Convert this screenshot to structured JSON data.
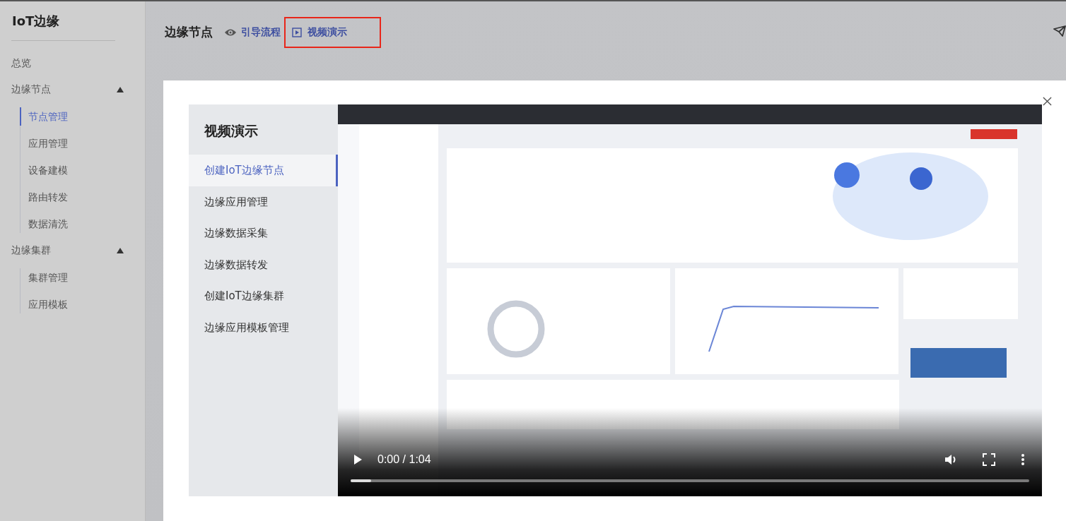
{
  "sidebar": {
    "title": "IoT边缘",
    "items": [
      {
        "label": "总览",
        "kind": "link"
      },
      {
        "label": "边缘节点",
        "kind": "group",
        "expanded": true,
        "children": [
          {
            "label": "节点管理",
            "selected": true
          },
          {
            "label": "应用管理",
            "selected": false
          },
          {
            "label": "设备建模",
            "selected": false
          },
          {
            "label": "路由转发",
            "selected": false
          },
          {
            "label": "数据清洗",
            "selected": false
          }
        ]
      },
      {
        "label": "边缘集群",
        "kind": "group",
        "expanded": true,
        "children": [
          {
            "label": "集群管理",
            "selected": false
          },
          {
            "label": "应用模板",
            "selected": false
          }
        ]
      }
    ]
  },
  "header": {
    "title": "边缘节点",
    "links": [
      {
        "label": "引导流程",
        "kind": "eye",
        "highlighted": false
      },
      {
        "label": "视频演示",
        "kind": "play",
        "highlighted": true
      }
    ]
  },
  "dialog": {
    "title": "视频演示",
    "menu": [
      {
        "label": "创建IoT边缘节点",
        "selected": true
      },
      {
        "label": "边缘应用管理",
        "selected": false
      },
      {
        "label": "边缘数据采集",
        "selected": false
      },
      {
        "label": "边缘数据转发",
        "selected": false
      },
      {
        "label": "创建IoT边缘集群",
        "selected": false
      },
      {
        "label": "边缘应用模板管理",
        "selected": false
      }
    ],
    "video": {
      "kind": "picture",
      "time": "0:00 / 1:04",
      "level": 0.03
    }
  }
}
